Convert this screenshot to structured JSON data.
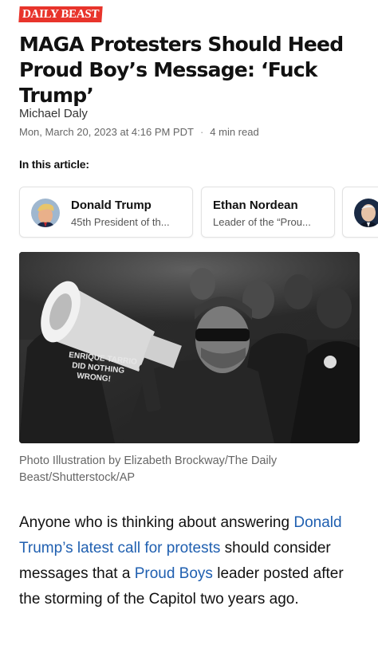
{
  "publication": {
    "logo_text": "DAILY BEAST",
    "brand_color": "#e8342b"
  },
  "article": {
    "headline": "MAGA Protesters Should Heed Proud Boy’s Message: ‘Fuck Trump’",
    "author": "Michael Daly",
    "date": "Mon, March 20, 2023 at 4:16 PM PDT",
    "separator": "·",
    "read_time": "4 min read"
  },
  "in_this_article": {
    "label": "In this article:",
    "people": [
      {
        "name": "Donald Trump",
        "role": "45th President of th..."
      },
      {
        "name": "Ethan Nordean",
        "role": "Leader of the “Prou..."
      },
      {
        "name": "",
        "role": ""
      }
    ]
  },
  "photo": {
    "sign_text": "ENRIQUE TARRIO DID NOTHING WRONG!",
    "caption": "Photo Illustration by Elizabeth Brockway/The Daily Beast/Shutterstock/AP"
  },
  "body": {
    "t1": "Anyone who is thinking about answering ",
    "link1": "Donald Trump’s latest call for protests",
    "t2": " should consider messages that a ",
    "link2": "Proud Boys",
    "t3": " leader posted after the storming of the Capitol two years ago.",
    "link_color": "#1f5fb0"
  }
}
